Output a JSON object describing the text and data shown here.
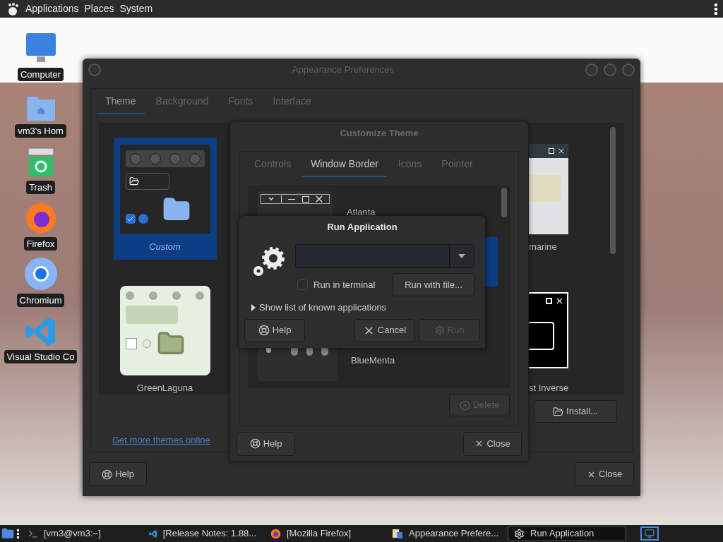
{
  "top_panel": {
    "menus": [
      "Applications",
      "Places",
      "System"
    ]
  },
  "desktop_icons": [
    {
      "label": "Computer",
      "kind": "computer"
    },
    {
      "label": "vm3's Hom",
      "kind": "home"
    },
    {
      "label": "Trash",
      "kind": "trash"
    },
    {
      "label": "Firefox",
      "kind": "firefox"
    },
    {
      "label": "Chromium",
      "kind": "chromium"
    },
    {
      "label": "Visual Studio Co",
      "kind": "vscode"
    }
  ],
  "appearance_window": {
    "title": "Appearance Preferences",
    "tabs": [
      {
        "label": "Theme",
        "selected": true
      },
      {
        "label": "Background",
        "selected": false
      },
      {
        "label": "Fonts",
        "selected": false
      },
      {
        "label": "Interface",
        "selected": false
      }
    ],
    "themes": [
      {
        "name": "Custom",
        "kind": "dark",
        "selected": true
      },
      {
        "name": "marine",
        "kind": "light",
        "selected": false
      },
      {
        "name": "GreenLaguna",
        "kind": "green",
        "selected": false
      },
      {
        "name": "st Inverse",
        "kind": "inverse",
        "selected": false
      }
    ],
    "link": "Get more themes online",
    "install_button": "Install...",
    "help_button": "Help",
    "close_button": "Close"
  },
  "customize_window": {
    "title": "Customize Theme",
    "tabs": [
      {
        "label": "Controls",
        "selected": false
      },
      {
        "label": "Window Border",
        "selected": true
      },
      {
        "label": "Icons",
        "selected": false
      },
      {
        "label": "Pointer",
        "selected": false
      }
    ],
    "borders": [
      {
        "name": "Atlanta",
        "kind": "atlanta",
        "selected": false
      },
      {
        "selected": true
      },
      {
        "selected": false
      },
      {
        "name": "BlueMenta",
        "kind": "bluementa",
        "selected": false
      }
    ],
    "delete_button": {
      "label": "Delete",
      "disabled": true
    },
    "help_button": "Help",
    "close_button": "Close"
  },
  "run_dialog": {
    "title": "Run Application",
    "run_in_terminal": {
      "label": "Run in terminal",
      "checked": false
    },
    "run_with_file_button": "Run with file...",
    "expander": {
      "label": "Show list of known applications",
      "expanded": false
    },
    "help_button": "Help",
    "cancel_button": "Cancel",
    "run_button": {
      "label": "Run",
      "disabled": true
    }
  },
  "taskbar": {
    "items": [
      {
        "label": "[vm3@vm3:~]",
        "kind": "terminal",
        "selected": false
      },
      {
        "label": "[Release Notes: 1.88...",
        "kind": "editor",
        "selected": false
      },
      {
        "label": "[Mozilla Firefox]",
        "kind": "firefox",
        "selected": false
      },
      {
        "label": "Appearance Prefere...",
        "kind": "appearance",
        "selected": false
      },
      {
        "label": "Run Application",
        "kind": "run",
        "selected": true
      }
    ]
  }
}
